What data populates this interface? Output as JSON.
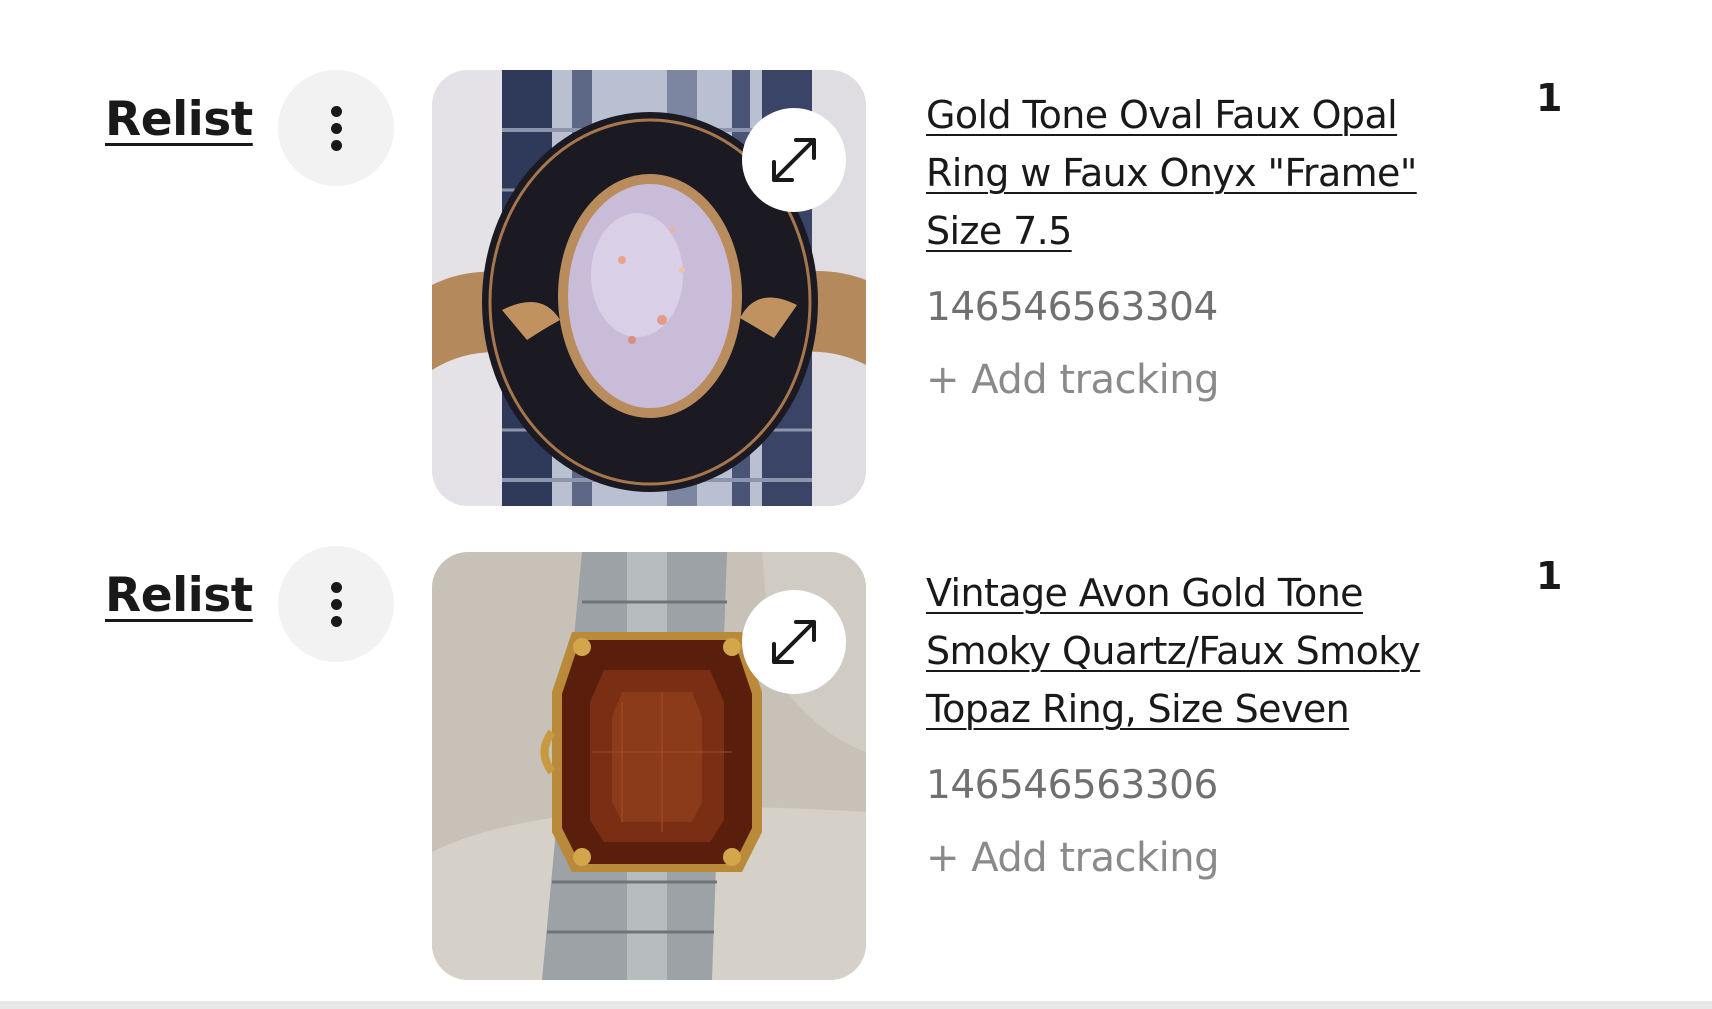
{
  "orders": [
    {
      "relist_label": "Relist",
      "title": "Gold Tone Oval Faux Opal Ring w Faux Onyx \"Frame\" Size 7.5",
      "order_number": "146546563304",
      "add_tracking_label": "+ Add tracking",
      "quantity": "1",
      "more_icon": "more-vertical-icon",
      "expand_icon": "expand-icon"
    },
    {
      "relist_label": "Relist",
      "title": "Vintage Avon Gold Tone Smoky Quartz/Faux Smoky Topaz Ring, Size Seven",
      "order_number": "146546563306",
      "add_tracking_label": "+ Add tracking",
      "quantity": "1",
      "more_icon": "more-vertical-icon",
      "expand_icon": "expand-icon"
    }
  ],
  "colors": {
    "text_primary": "#191919",
    "text_secondary": "#707070",
    "text_tertiary": "#8a8a8a",
    "button_background": "#f2f2f2"
  }
}
